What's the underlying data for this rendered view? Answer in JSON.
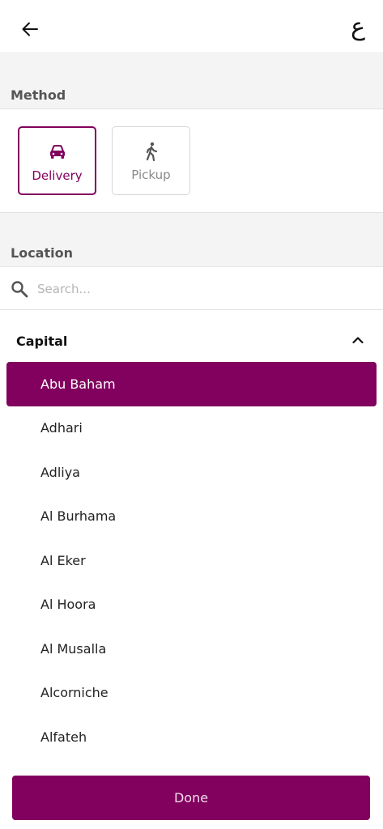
{
  "header": {
    "language_toggle": "ع"
  },
  "method_section": {
    "title": "Method",
    "options": [
      {
        "label": "Delivery",
        "icon": "car-icon",
        "selected": true
      },
      {
        "label": "Pickup",
        "icon": "walking-person-icon",
        "selected": false
      }
    ]
  },
  "location_section": {
    "title": "Location",
    "search": {
      "placeholder": "Search...",
      "value": ""
    },
    "group": {
      "name": "Capital",
      "expanded": true,
      "areas": [
        "Abu Baham",
        "Adhari",
        "Adliya",
        "Al Burhama",
        "Al Eker",
        "Al Hoora",
        "Al Musalla",
        "Alcorniche",
        "Alfateh"
      ],
      "selected_index": 0
    }
  },
  "footer": {
    "done_label": "Done"
  },
  "colors": {
    "accent": "#82005e",
    "section_bg": "#f4f4f4"
  }
}
